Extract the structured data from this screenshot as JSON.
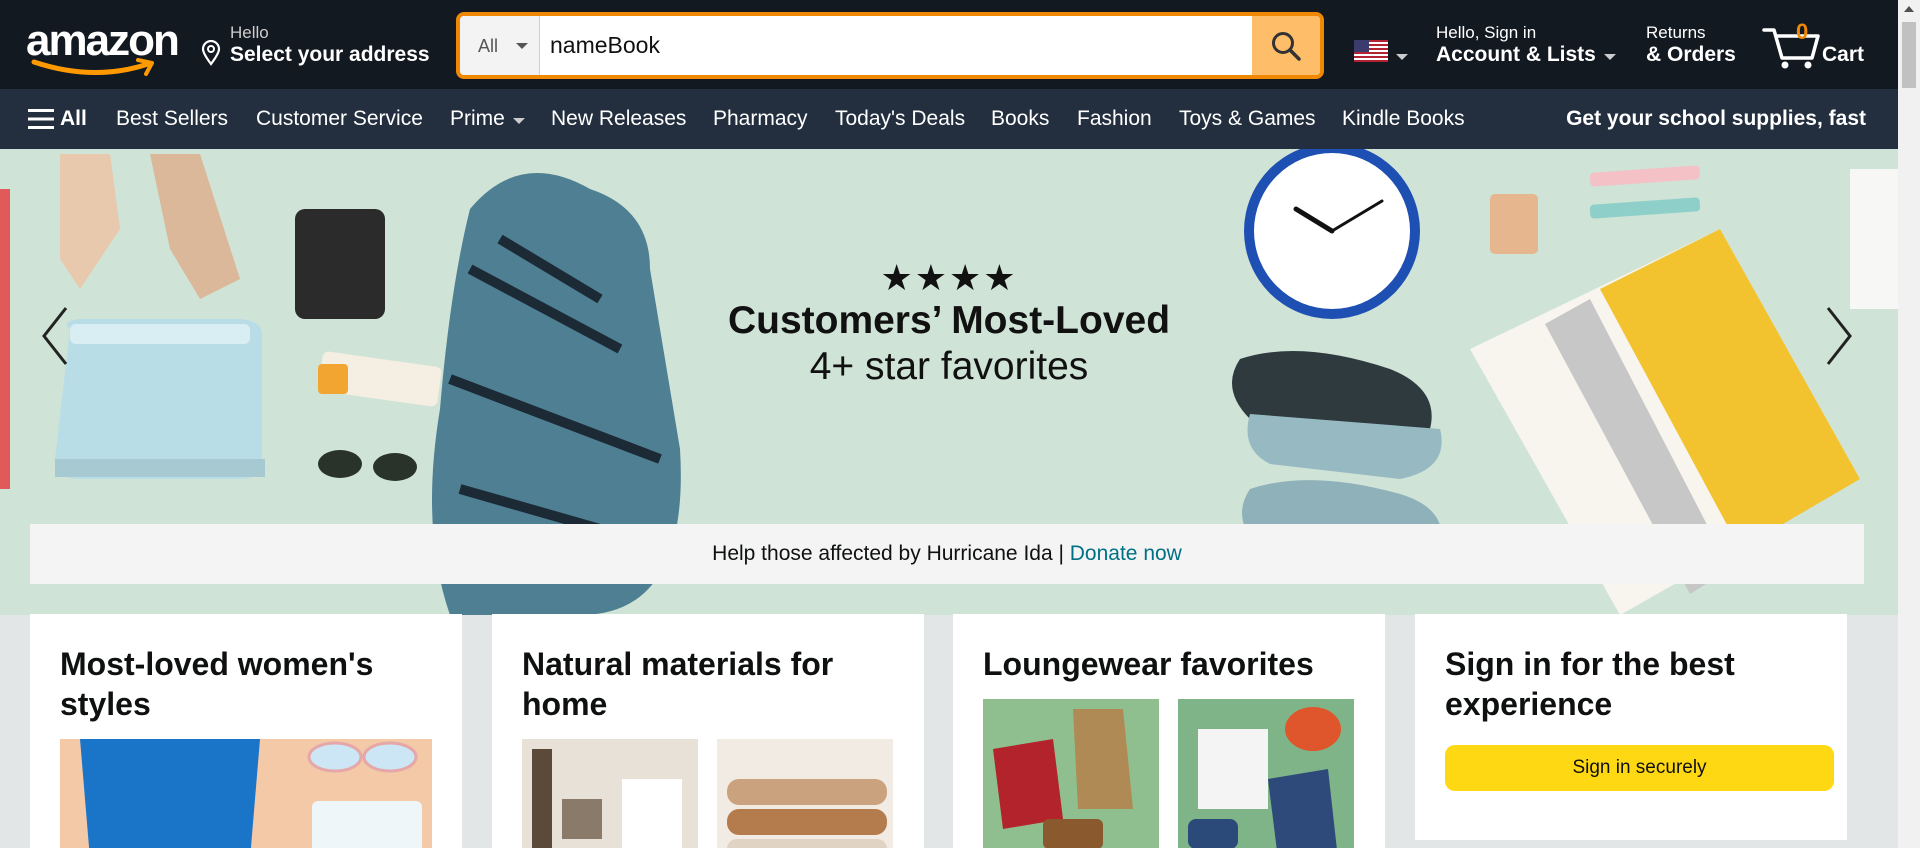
{
  "header": {
    "logo_text": "amazon",
    "address": {
      "line1": "Hello",
      "line2": "Select your address"
    },
    "search": {
      "category": "All",
      "query": "nameBook",
      "placeholder": ""
    },
    "account": {
      "line1": "Hello, Sign in",
      "line2": "Account & Lists"
    },
    "returns": {
      "line1": "Returns",
      "line2": "& Orders"
    },
    "cart": {
      "count": "0",
      "label": "Cart"
    }
  },
  "nav": {
    "all_label": "All",
    "items": [
      "Best Sellers",
      "Customer Service",
      "Prime",
      "New Releases",
      "Pharmacy",
      "Today's Deals",
      "Books",
      "Fashion",
      "Toys & Games",
      "Kindle Books"
    ],
    "promo": "Get your school supplies, fast"
  },
  "hero": {
    "stars": "★★★★",
    "title": "Customers’ Most-Loved",
    "subtitle": "4+ star favorites"
  },
  "notice": {
    "text": "Help those affected by Hurricane Ida | ",
    "link": "Donate now"
  },
  "cards": [
    {
      "title": "Most-loved women's styles"
    },
    {
      "title": "Natural materials for home"
    },
    {
      "title": "Loungewear favorites"
    },
    {
      "title": "Sign in for the best experience",
      "button": "Sign in securely"
    }
  ],
  "colors": {
    "header_bg": "#131921",
    "nav_bg": "#232f3e",
    "search_border": "#f08804",
    "search_button": "#febd69",
    "sign_in_button": "#ffd814",
    "link": "#007185",
    "hero_bg": "#cfe3d7"
  }
}
